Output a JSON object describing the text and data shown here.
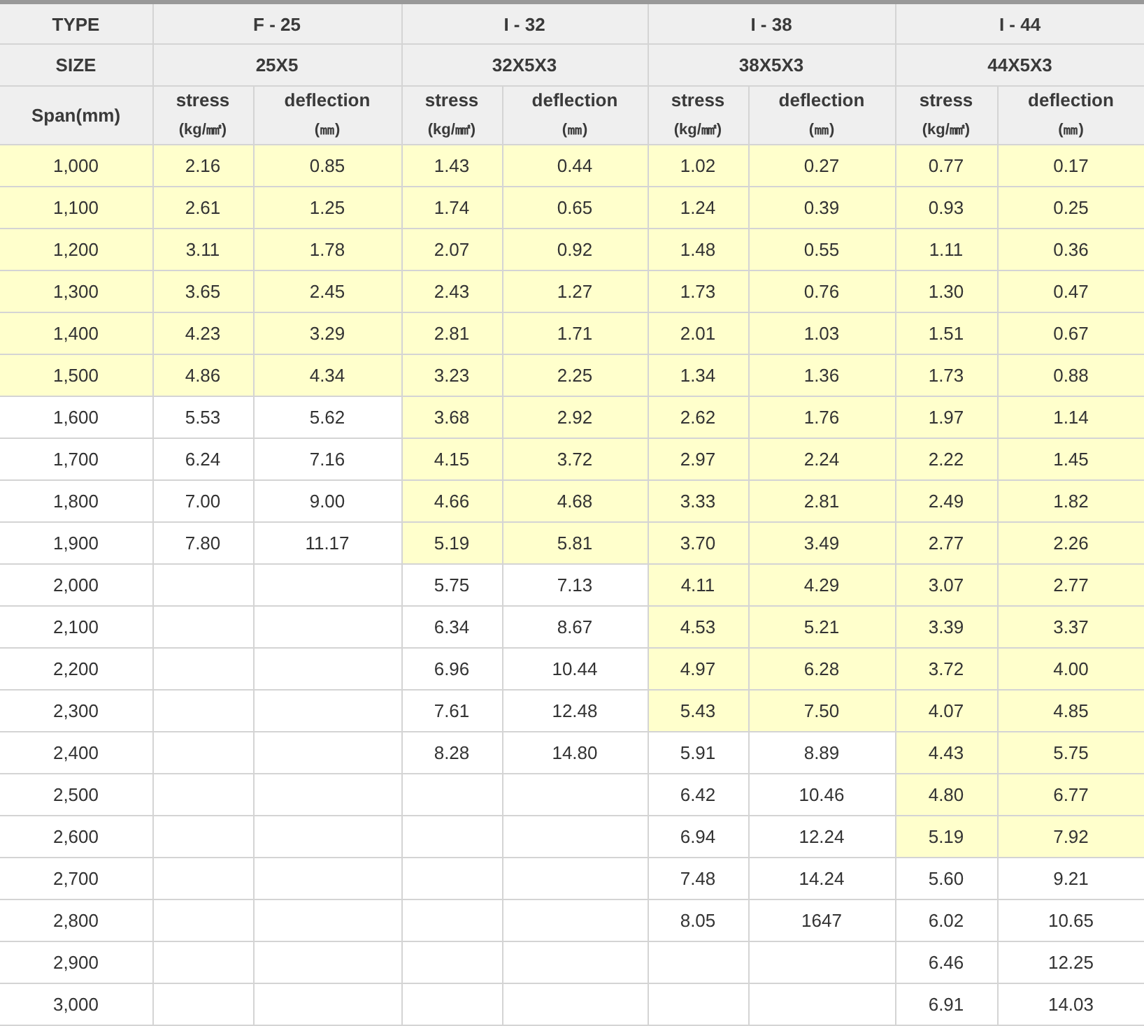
{
  "table": {
    "type_label": "TYPE",
    "size_label": "SIZE",
    "span_label": "Span(mm)",
    "groups": [
      {
        "type": "F - 25",
        "size": "25X5",
        "stress": "stress",
        "stress_unit": "(kg/㎟)",
        "deflection": "deflection",
        "deflection_unit": "(㎜)"
      },
      {
        "type": "I - 32",
        "size": "32X5X3",
        "stress": "stress",
        "stress_unit": "(kg/㎟)",
        "deflection": "deflection",
        "deflection_unit": "(㎜)"
      },
      {
        "type": "I - 38",
        "size": "38X5X3",
        "stress": "stress",
        "stress_unit": "(kg/㎟)",
        "deflection": "deflection",
        "deflection_unit": "(㎜)"
      },
      {
        "type": "I - 44",
        "size": "44X5X3",
        "stress": "stress",
        "stress_unit": "(kg/㎟)",
        "deflection": "deflection",
        "deflection_unit": "(㎜)"
      }
    ],
    "rows": [
      {
        "span": "1,000",
        "highlighted": true,
        "cells": [
          {
            "stress": "2.16",
            "deflection": "0.85",
            "highlighted": true
          },
          {
            "stress": "1.43",
            "deflection": "0.44",
            "highlighted": true
          },
          {
            "stress": "1.02",
            "deflection": "0.27",
            "highlighted": true
          },
          {
            "stress": "0.77",
            "deflection": "0.17",
            "highlighted": true
          }
        ]
      },
      {
        "span": "1,100",
        "highlighted": true,
        "cells": [
          {
            "stress": "2.61",
            "deflection": "1.25",
            "highlighted": true
          },
          {
            "stress": "1.74",
            "deflection": "0.65",
            "highlighted": true
          },
          {
            "stress": "1.24",
            "deflection": "0.39",
            "highlighted": true
          },
          {
            "stress": "0.93",
            "deflection": "0.25",
            "highlighted": true
          }
        ]
      },
      {
        "span": "1,200",
        "highlighted": true,
        "cells": [
          {
            "stress": "3.11",
            "deflection": "1.78",
            "highlighted": true
          },
          {
            "stress": "2.07",
            "deflection": "0.92",
            "highlighted": true
          },
          {
            "stress": "1.48",
            "deflection": "0.55",
            "highlighted": true
          },
          {
            "stress": "1.11",
            "deflection": "0.36",
            "highlighted": true
          }
        ]
      },
      {
        "span": "1,300",
        "highlighted": true,
        "cells": [
          {
            "stress": "3.65",
            "deflection": "2.45",
            "highlighted": true
          },
          {
            "stress": "2.43",
            "deflection": "1.27",
            "highlighted": true
          },
          {
            "stress": "1.73",
            "deflection": "0.76",
            "highlighted": true
          },
          {
            "stress": "1.30",
            "deflection": "0.47",
            "highlighted": true
          }
        ]
      },
      {
        "span": "1,400",
        "highlighted": true,
        "cells": [
          {
            "stress": "4.23",
            "deflection": "3.29",
            "highlighted": true
          },
          {
            "stress": "2.81",
            "deflection": "1.71",
            "highlighted": true
          },
          {
            "stress": "2.01",
            "deflection": "1.03",
            "highlighted": true
          },
          {
            "stress": "1.51",
            "deflection": "0.67",
            "highlighted": true
          }
        ]
      },
      {
        "span": "1,500",
        "highlighted": true,
        "cells": [
          {
            "stress": "4.86",
            "deflection": "4.34",
            "highlighted": true
          },
          {
            "stress": "3.23",
            "deflection": "2.25",
            "highlighted": true
          },
          {
            "stress": "1.34",
            "deflection": "1.36",
            "highlighted": true
          },
          {
            "stress": "1.73",
            "deflection": "0.88",
            "highlighted": true
          }
        ]
      },
      {
        "span": "1,600",
        "highlighted": false,
        "cells": [
          {
            "stress": "5.53",
            "deflection": "5.62",
            "highlighted": false
          },
          {
            "stress": "3.68",
            "deflection": "2.92",
            "highlighted": true
          },
          {
            "stress": "2.62",
            "deflection": "1.76",
            "highlighted": true
          },
          {
            "stress": "1.97",
            "deflection": "1.14",
            "highlighted": true
          }
        ]
      },
      {
        "span": "1,700",
        "highlighted": false,
        "cells": [
          {
            "stress": "6.24",
            "deflection": "7.16",
            "highlighted": false
          },
          {
            "stress": "4.15",
            "deflection": "3.72",
            "highlighted": true
          },
          {
            "stress": "2.97",
            "deflection": "2.24",
            "highlighted": true
          },
          {
            "stress": "2.22",
            "deflection": "1.45",
            "highlighted": true
          }
        ]
      },
      {
        "span": "1,800",
        "highlighted": false,
        "cells": [
          {
            "stress": "7.00",
            "deflection": "9.00",
            "highlighted": false
          },
          {
            "stress": "4.66",
            "deflection": "4.68",
            "highlighted": true
          },
          {
            "stress": "3.33",
            "deflection": "2.81",
            "highlighted": true
          },
          {
            "stress": "2.49",
            "deflection": "1.82",
            "highlighted": true
          }
        ]
      },
      {
        "span": "1,900",
        "highlighted": false,
        "cells": [
          {
            "stress": "7.80",
            "deflection": "11.17",
            "highlighted": false
          },
          {
            "stress": "5.19",
            "deflection": "5.81",
            "highlighted": true
          },
          {
            "stress": "3.70",
            "deflection": "3.49",
            "highlighted": true
          },
          {
            "stress": "2.77",
            "deflection": "2.26",
            "highlighted": true
          }
        ]
      },
      {
        "span": "2,000",
        "highlighted": false,
        "cells": [
          null,
          {
            "stress": "5.75",
            "deflection": "7.13",
            "highlighted": false
          },
          {
            "stress": "4.11",
            "deflection": "4.29",
            "highlighted": true
          },
          {
            "stress": "3.07",
            "deflection": "2.77",
            "highlighted": true
          }
        ]
      },
      {
        "span": "2,100",
        "highlighted": false,
        "cells": [
          null,
          {
            "stress": "6.34",
            "deflection": "8.67",
            "highlighted": false
          },
          {
            "stress": "4.53",
            "deflection": "5.21",
            "highlighted": true
          },
          {
            "stress": "3.39",
            "deflection": "3.37",
            "highlighted": true
          }
        ]
      },
      {
        "span": "2,200",
        "highlighted": false,
        "cells": [
          null,
          {
            "stress": "6.96",
            "deflection": "10.44",
            "highlighted": false
          },
          {
            "stress": "4.97",
            "deflection": "6.28",
            "highlighted": true
          },
          {
            "stress": "3.72",
            "deflection": "4.00",
            "highlighted": true
          }
        ]
      },
      {
        "span": "2,300",
        "highlighted": false,
        "cells": [
          null,
          {
            "stress": "7.61",
            "deflection": "12.48",
            "highlighted": false
          },
          {
            "stress": "5.43",
            "deflection": "7.50",
            "highlighted": true
          },
          {
            "stress": "4.07",
            "deflection": "4.85",
            "highlighted": true
          }
        ]
      },
      {
        "span": "2,400",
        "highlighted": false,
        "cells": [
          null,
          {
            "stress": "8.28",
            "deflection": "14.80",
            "highlighted": false
          },
          {
            "stress": "5.91",
            "deflection": "8.89",
            "highlighted": false
          },
          {
            "stress": "4.43",
            "deflection": "5.75",
            "highlighted": true
          }
        ]
      },
      {
        "span": "2,500",
        "highlighted": false,
        "cells": [
          null,
          null,
          {
            "stress": "6.42",
            "deflection": "10.46",
            "highlighted": false
          },
          {
            "stress": "4.80",
            "deflection": "6.77",
            "highlighted": true
          }
        ]
      },
      {
        "span": "2,600",
        "highlighted": false,
        "cells": [
          null,
          null,
          {
            "stress": "6.94",
            "deflection": "12.24",
            "highlighted": false
          },
          {
            "stress": "5.19",
            "deflection": "7.92",
            "highlighted": true
          }
        ]
      },
      {
        "span": "2,700",
        "highlighted": false,
        "cells": [
          null,
          null,
          {
            "stress": "7.48",
            "deflection": "14.24",
            "highlighted": false
          },
          {
            "stress": "5.60",
            "deflection": "9.21",
            "highlighted": false
          }
        ]
      },
      {
        "span": "2,800",
        "highlighted": false,
        "cells": [
          null,
          null,
          {
            "stress": "8.05",
            "deflection": "1647",
            "highlighted": false
          },
          {
            "stress": "6.02",
            "deflection": "10.65",
            "highlighted": false
          }
        ]
      },
      {
        "span": "2,900",
        "highlighted": false,
        "cells": [
          null,
          null,
          null,
          {
            "stress": "6.46",
            "deflection": "12.25",
            "highlighted": false
          }
        ]
      },
      {
        "span": "3,000",
        "highlighted": false,
        "cells": [
          null,
          null,
          null,
          {
            "stress": "6.91",
            "deflection": "14.03",
            "highlighted": false
          }
        ]
      }
    ]
  }
}
